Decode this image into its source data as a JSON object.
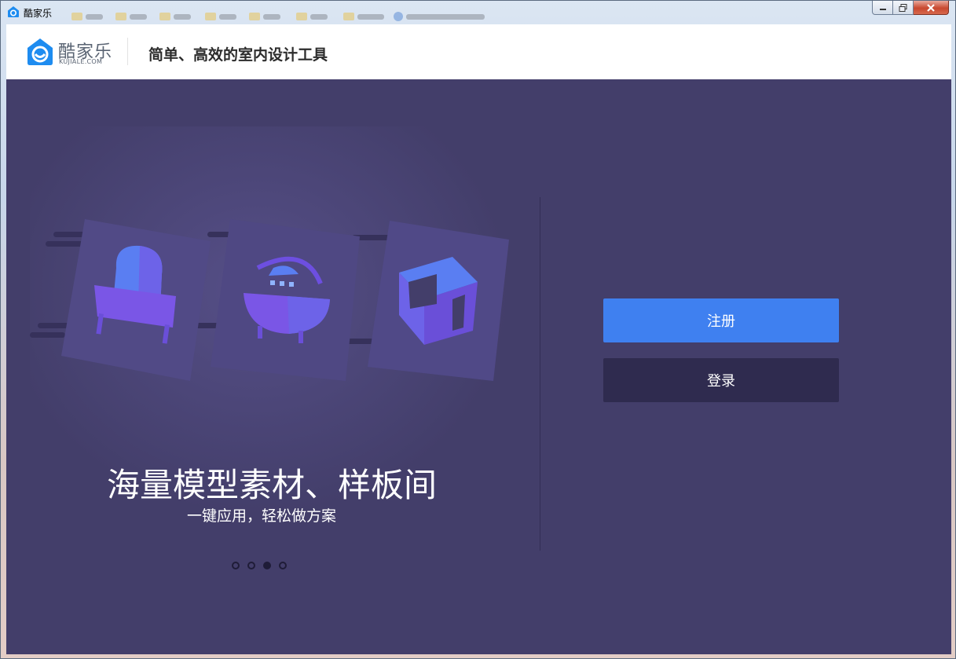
{
  "window": {
    "title": "酷家乐",
    "controls": {
      "minimize_icon": "minimize-icon",
      "maximize_icon": "maximize-icon",
      "close_icon": "close-icon"
    }
  },
  "header": {
    "logo_cn": "酷家乐",
    "logo_en": "KUJIALE.COM",
    "tagline": "简单、高效的室内设计工具"
  },
  "carousel": {
    "headline": "海量模型素材、样板间",
    "subline": "一键应用，轻松做方案",
    "slide_count": 4,
    "active_slide": 3,
    "illustrations": [
      "armchair-icon",
      "bathtub-icon",
      "room-cube-icon"
    ]
  },
  "actions": {
    "register_label": "注册",
    "login_label": "登录"
  },
  "colors": {
    "background": "#433e6a",
    "register_button": "#3f80f0",
    "login_button": "#2f2b4f",
    "brand_blue": "#1e8cf0"
  }
}
